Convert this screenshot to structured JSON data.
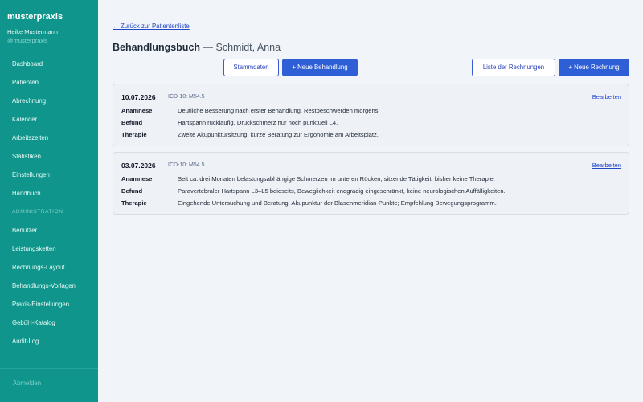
{
  "sidebar": {
    "brand": "musterpraxis",
    "user_name": "Heike Mustermann",
    "user_handle": "@musterpraxis",
    "nav_items": [
      "Dashboard",
      "Patienten",
      "Abrechnung",
      "Kalender",
      "Arbeitszeiten",
      "Statistiken",
      "Einstellungen",
      "Handbuch"
    ],
    "admin_section": "ADMINISTRATION",
    "admin_items": [
      "Benutzer",
      "Leistungsketten",
      "Rechnungs-Layout",
      "Behandlungs-Vorlagen",
      "Praxis-Einstellungen",
      "GebüH-Katalog",
      "Audit-Log"
    ],
    "logout": "Abmelden"
  },
  "main": {
    "back_link": "← Zurück zur Patientenliste",
    "page_title": "Behandlungsbuch",
    "title_separator": " — ",
    "patient_name": "Schmidt, Anna",
    "buttons": {
      "stammdaten": "Stammdaten",
      "neue_behandlung": "+ Neue Behandlung",
      "liste_rechnungen": "Liste der Rechnungen",
      "neue_rechnung": "+ Neue Rechnung"
    },
    "entries": [
      {
        "date": "10.07.2026",
        "icd": "ICD-10: M54.5",
        "edit": "Bearbeiten",
        "rows": [
          {
            "label": "Anamnese",
            "value": "Deutliche Besserung nach erster Behandlung, Restbeschwerden morgens."
          },
          {
            "label": "Befund",
            "value": "Hartspann rückläufig, Druckschmerz nur noch punktuell L4."
          },
          {
            "label": "Therapie",
            "value": "Zweite Akupunktursitzung; kurze Beratung zur Ergonomie am Arbeitsplatz."
          }
        ]
      },
      {
        "date": "03.07.2026",
        "icd": "ICD-10: M54.5",
        "edit": "Bearbeiten",
        "rows": [
          {
            "label": "Anamnese",
            "value": "Seit ca. drei Monaten belastungsabhängige Schmerzen im unteren Rücken, sitzende Tätigkeit, bisher keine Therapie."
          },
          {
            "label": "Befund",
            "value": "Paravertebraler Hartspann L3–L5 beidseits, Beweglichkeit endgradig eingeschränkt, keine neurologischen Auffälligkeiten."
          },
          {
            "label": "Therapie",
            "value": "Eingehende Untersuchung und Beratung; Akupunktur der Blasenmeridian-Punkte; Empfehlung Bewegungsprogramm."
          }
        ]
      }
    ]
  },
  "colors": {
    "sidebar_bg": "#0f958b",
    "primary": "#2f5fd6",
    "link": "#2347c9",
    "page_bg": "#f1f4f8"
  }
}
